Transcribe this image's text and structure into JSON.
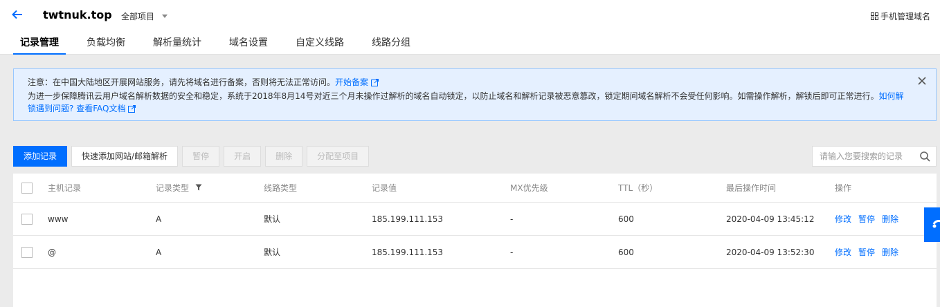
{
  "header": {
    "domain": "twtnuk.top",
    "project_select": "全部项目",
    "mobile_manage": "手机管理域名"
  },
  "tabs": [
    {
      "label": "记录管理",
      "active": true
    },
    {
      "label": "负载均衡"
    },
    {
      "label": "解析量统计"
    },
    {
      "label": "域名设置"
    },
    {
      "label": "自定义线路"
    },
    {
      "label": "线路分组"
    }
  ],
  "notice": {
    "line1_text": "注意：在中国大陆地区开展网站服务，请先将域名进行备案，否则将无法正常访问。",
    "line1_link": "开始备案",
    "line2_text": "为进一步保障腾讯云用户域名解析数据的安全和稳定，系统于2018年8月14号对近三个月未操作过解析的域名自动锁定，以防止域名和解析记录被恶意篡改，锁定期间域名解析不会受任何影响。如需操作解析，解锁后即可正常进行。",
    "line2_link1": "如何解锁遇到问题?",
    "line2_link2": "查看FAQ文档"
  },
  "toolbar": {
    "add": "添加记录",
    "quick_add": "快速添加网站/邮箱解析",
    "pause": "暂停",
    "enable": "开启",
    "delete": "删除",
    "assign": "分配至项目"
  },
  "search": {
    "placeholder": "请输入您要搜索的记录"
  },
  "table": {
    "headers": {
      "host": "主机记录",
      "type": "记录类型",
      "line": "线路类型",
      "value": "记录值",
      "mx": "MX优先级",
      "ttl": "TTL（秒）",
      "time": "最后操作时间",
      "ops": "操作"
    },
    "rows": [
      {
        "host": "www",
        "type": "A",
        "line": "默认",
        "value": "185.199.111.153",
        "mx": "-",
        "ttl": "600",
        "time": "2020-04-09 13:45:12",
        "op_edit": "修改",
        "op_pause": "暂停",
        "op_delete": "删除"
      },
      {
        "host": "@",
        "type": "A",
        "line": "默认",
        "value": "185.199.111.153",
        "mx": "-",
        "ttl": "600",
        "time": "2020-04-09 13:52:30",
        "op_edit": "修改",
        "op_pause": "暂停",
        "op_delete": "删除"
      }
    ]
  },
  "colors": {
    "accent": "#006eff",
    "notice_bg": "#e5f0ff",
    "notice_border": "#97c7ff"
  },
  "icons": [
    "arrow-left-icon",
    "caret-down-icon",
    "grid-icon",
    "external-link-icon",
    "close-icon",
    "search-icon",
    "filter-icon"
  ]
}
